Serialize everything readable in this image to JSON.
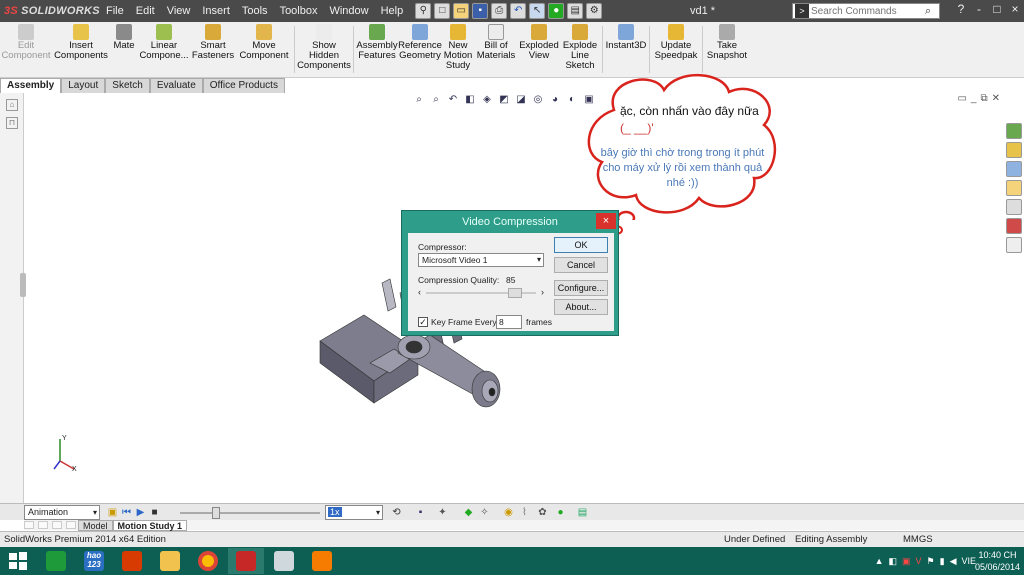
{
  "app": {
    "brand": "SOLIDWORKS",
    "document_title": "vd1 *",
    "menus": [
      "File",
      "Edit",
      "View",
      "Insert",
      "Tools",
      "Toolbox",
      "Window",
      "Help"
    ],
    "search_placeholder": "Search Commands",
    "window_controls": [
      "?",
      "-",
      "□",
      "×"
    ]
  },
  "command_manager": {
    "items": [
      {
        "label": "Edit\nComponent",
        "icon": "edit-component-icon"
      },
      {
        "label": "Insert\nComponents",
        "icon": "insert-components-icon"
      },
      {
        "label": "Mate",
        "icon": "mate-icon"
      },
      {
        "label": "Linear\nCompone...",
        "icon": "linear-pattern-icon"
      },
      {
        "label": "Smart\nFasteners",
        "icon": "smart-fasteners-icon"
      },
      {
        "label": "Move\nComponent",
        "icon": "move-component-icon"
      },
      {
        "label": "Show\nHidden\nComponents",
        "icon": "show-hidden-icon"
      },
      {
        "label": "Assembly\nFeatures",
        "icon": "assembly-features-icon"
      },
      {
        "label": "Reference\nGeometry",
        "icon": "reference-geometry-icon"
      },
      {
        "label": "New\nMotion\nStudy",
        "icon": "motion-study-icon"
      },
      {
        "label": "Bill of\nMaterials",
        "icon": "bom-icon"
      },
      {
        "label": "Exploded\nView",
        "icon": "exploded-view-icon"
      },
      {
        "label": "Explode\nLine\nSketch",
        "icon": "explode-line-icon"
      },
      {
        "label": "Instant3D",
        "icon": "instant3d-icon"
      },
      {
        "label": "Update\nSpeedpak",
        "icon": "speedpak-icon"
      },
      {
        "label": "Take\nSnapshot",
        "icon": "snapshot-icon"
      }
    ]
  },
  "tabs": [
    "Assembly",
    "Layout",
    "Sketch",
    "Evaluate",
    "Office Products"
  ],
  "triad": {
    "axis_y": "Y",
    "axis_x": "X"
  },
  "bubble": {
    "line1": "ặc, còn nhấn vào đây nữa ",
    "line1_emote": "(_ __)'",
    "line2": "bây giờ thì chờ trong trong ít phút cho máy xử lý rồi xem thành quả nhé :))"
  },
  "dialog": {
    "title": "Video Compression",
    "close": "×",
    "compressor_label": "Compressor:",
    "compressor_value": "Microsoft Video 1",
    "quality_label": "Compression Quality:",
    "quality_value": "85",
    "keyframe_label": "Key Frame Every",
    "keyframe_value": "8",
    "keyframe_unit": "frames",
    "keyframe_checked": true,
    "buttons": {
      "ok": "OK",
      "cancel": "Cancel",
      "configure": "Configure...",
      "about": "About..."
    }
  },
  "motion": {
    "study_type": "Animation",
    "speed": "1x",
    "tabs": [
      "Model",
      "Motion Study 1"
    ]
  },
  "status": {
    "edition": "SolidWorks Premium 2014 x64 Edition",
    "state": "Under Defined",
    "mode": "Editing Assembly",
    "units": "MMGS"
  },
  "taskbar": {
    "lang": "VIE",
    "time": "10:40 CH",
    "date": "05/06/2014",
    "hao123": "hao\n123"
  }
}
